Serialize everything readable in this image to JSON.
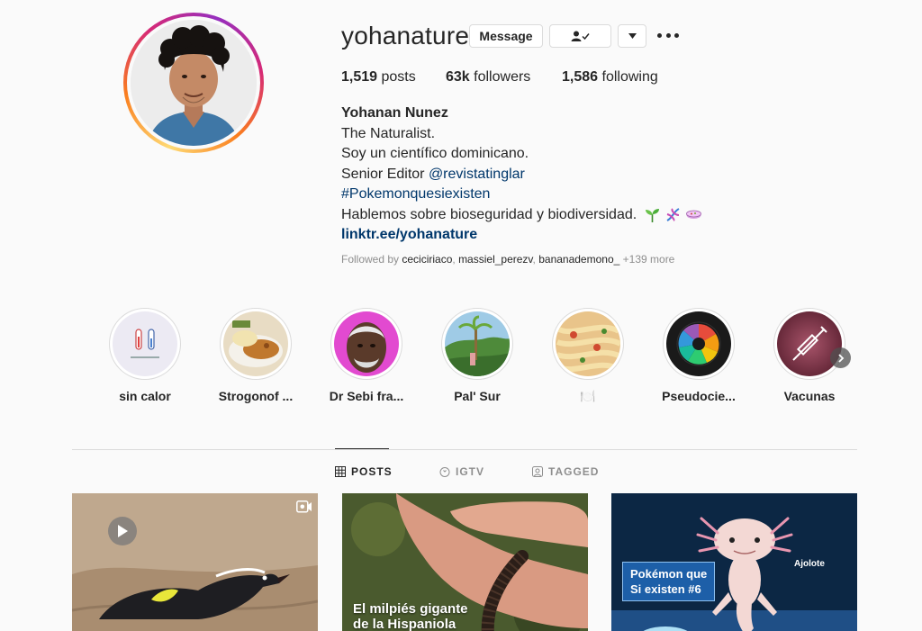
{
  "profile": {
    "username": "yohanature",
    "message_label": "Message",
    "follow_icon": "person-check-icon",
    "stats": {
      "posts_count": "1,519",
      "posts_label": "posts",
      "followers_count": "63k",
      "followers_label": "followers",
      "following_count": "1,586",
      "following_label": "following"
    },
    "bio": {
      "name": "Yohanan Nunez",
      "line1": "The Naturalist.",
      "line2": "Soy un científico dominicano.",
      "line3_prefix": "Senior Editor ",
      "line3_mention": "@revistatinglar",
      "hashtag": "#Pokemonquesiexisten",
      "line5": "Hablemos sobre bioseguridad y biodiversidad.",
      "emojis": [
        "seedling",
        "dna",
        "petri-dish"
      ],
      "website": "linktr.ee/yohanature"
    },
    "followed_by": {
      "prefix": "Followed by ",
      "user1": "ceciciriaco",
      "user2": "massiel_perezv",
      "user3": "bananademono_",
      "more": "+139 more",
      "sep": ", "
    }
  },
  "highlights": [
    {
      "label": "sin calor"
    },
    {
      "label": "Strogonof ..."
    },
    {
      "label": "Dr Sebi fra..."
    },
    {
      "label": "Pal' Sur"
    },
    {
      "label": "🍽️"
    },
    {
      "label": "Pseudocie..."
    },
    {
      "label": "Vacunas"
    }
  ],
  "tabs": [
    {
      "label": "POSTS",
      "active": true
    },
    {
      "label": "IGTV",
      "active": false
    },
    {
      "label": "TAGGED",
      "active": false
    }
  ],
  "posts": [
    {
      "caption": ""
    },
    {
      "caption_line1": "El milpiés gigante",
      "caption_line2": "de la Hispaniola"
    },
    {
      "badge_line1": "Pokémon que",
      "badge_line2": "Si existen #6",
      "label": "Ajolote"
    }
  ],
  "colors": {
    "link": "#00376b",
    "text": "#262626",
    "muted": "#8e8e8e",
    "border": "#dbdbdb"
  }
}
